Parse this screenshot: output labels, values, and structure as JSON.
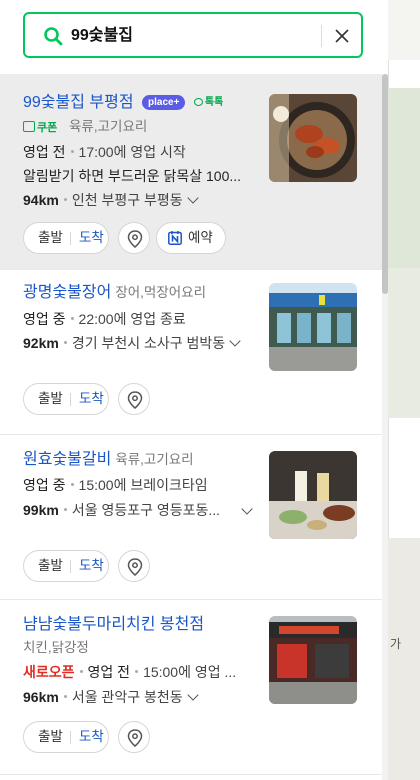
{
  "search": {
    "query": "99숯불집",
    "search_icon": "search-icon",
    "clear_icon": "close-icon"
  },
  "results": [
    {
      "name": "99숯불집 부평점",
      "badges": {
        "place_plus": "place+",
        "talktalk": "톡톡"
      },
      "coupon": "쿠폰",
      "category": "육류,고기요리",
      "status": "영업 전",
      "hours": "17:00에 영업 시작",
      "notice": "알림받기 하면 부드러운 닭목살 100...",
      "distance": "94km",
      "address": "인천 부평구 부평동",
      "buttons": {
        "depart": "출발",
        "arrive": "도착",
        "reserve": "예약"
      }
    },
    {
      "name": "광명숯불장어",
      "category": "장어,먹장어요리",
      "status": "영업 중",
      "hours": "22:00에 영업 종료",
      "distance": "92km",
      "address": "경기 부천시 소사구 범박동",
      "buttons": {
        "depart": "출발",
        "arrive": "도착"
      }
    },
    {
      "name": "원효숯불갈비",
      "category": "육류,고기요리",
      "status": "영업 중",
      "hours": "15:00에 브레이크타임",
      "distance": "99km",
      "address": "서울 영등포구 영등포동...",
      "buttons": {
        "depart": "출발",
        "arrive": "도착"
      }
    },
    {
      "name": "냠냠숯불두마리치킨 봉천점",
      "category": "치킨,닭강정",
      "status": "새로오픈",
      "status2": "영업 전",
      "hours": "15:00에 영업 ...",
      "distance": "96km",
      "address": "서울 관악구 봉천동",
      "buttons": {
        "depart": "출발",
        "arrive": "도착"
      }
    }
  ],
  "map": {
    "label": "가"
  },
  "colors": {
    "accent_green": "#03c75a",
    "link_blue": "#1a56c8",
    "new_red": "#e02e24",
    "place_plus_purple": "#5b5ce6"
  }
}
